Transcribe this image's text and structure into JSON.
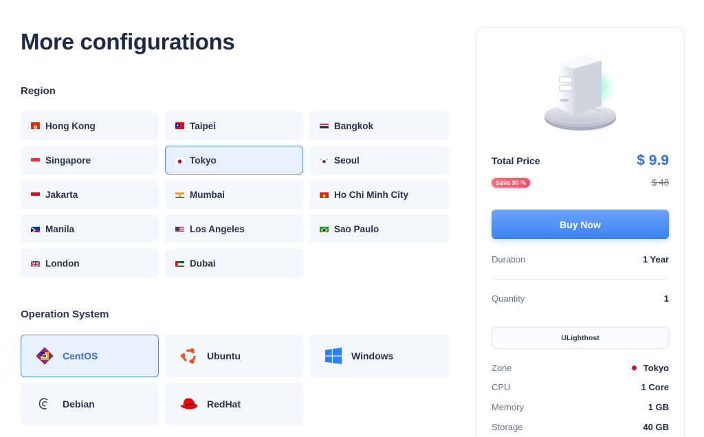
{
  "page": {
    "title": "More configurations"
  },
  "region": {
    "label": "Region",
    "items": [
      {
        "name": "Hong Kong",
        "flag": "hong-kong-flag-icon"
      },
      {
        "name": "Taipei",
        "flag": "taiwan-flag-icon"
      },
      {
        "name": "Bangkok",
        "flag": "thailand-flag-icon"
      },
      {
        "name": "Singapore",
        "flag": "singapore-flag-icon"
      },
      {
        "name": "Tokyo",
        "flag": "japan-flag-icon",
        "selected": true
      },
      {
        "name": "Seoul",
        "flag": "korea-flag-icon"
      },
      {
        "name": "Jakarta",
        "flag": "indonesia-flag-icon"
      },
      {
        "name": "Mumbai",
        "flag": "india-flag-icon"
      },
      {
        "name": "Ho Chi Minh City",
        "flag": "vietnam-flag-icon"
      },
      {
        "name": "Manila",
        "flag": "philippines-flag-icon"
      },
      {
        "name": "Los Angeles",
        "flag": "usa-flag-icon"
      },
      {
        "name": "Sao Paulo",
        "flag": "brazil-flag-icon"
      },
      {
        "name": "London",
        "flag": "uk-flag-icon"
      },
      {
        "name": "Dubai",
        "flag": "uae-flag-icon"
      }
    ]
  },
  "os": {
    "label": "Operation System",
    "items": [
      {
        "name": "CentOS",
        "icon": "centos-icon",
        "selected": true
      },
      {
        "name": "Ubuntu",
        "icon": "ubuntu-icon"
      },
      {
        "name": "Windows",
        "icon": "windows-icon"
      },
      {
        "name": "Debian",
        "icon": "debian-icon"
      },
      {
        "name": "RedHat",
        "icon": "redhat-icon"
      }
    ]
  },
  "summary": {
    "total_label": "Total Price",
    "price": "$ 9.9",
    "save_badge": "Save 80 %",
    "old_price": "$ 48",
    "buy_label": "Buy Now",
    "duration_label": "Duration",
    "duration_value": "1 Year",
    "quantity_label": "Quantity",
    "quantity_value": "1",
    "host_name": "ULighthost",
    "zone_label": "Zone",
    "zone_value": "Tokyo",
    "cpu_label": "CPU",
    "cpu_value": "1 Core",
    "memory_label": "Memory",
    "memory_value": "1 GB",
    "storage_label": "Storage",
    "storage_value": "40 GB"
  },
  "colors": {
    "accent": "#2f6fe0",
    "selected_border": "#5b8fe6",
    "selected_bg": "#e7f0fd",
    "card_bg": "#f4f7fc",
    "save_badge": "#ff4f66"
  }
}
